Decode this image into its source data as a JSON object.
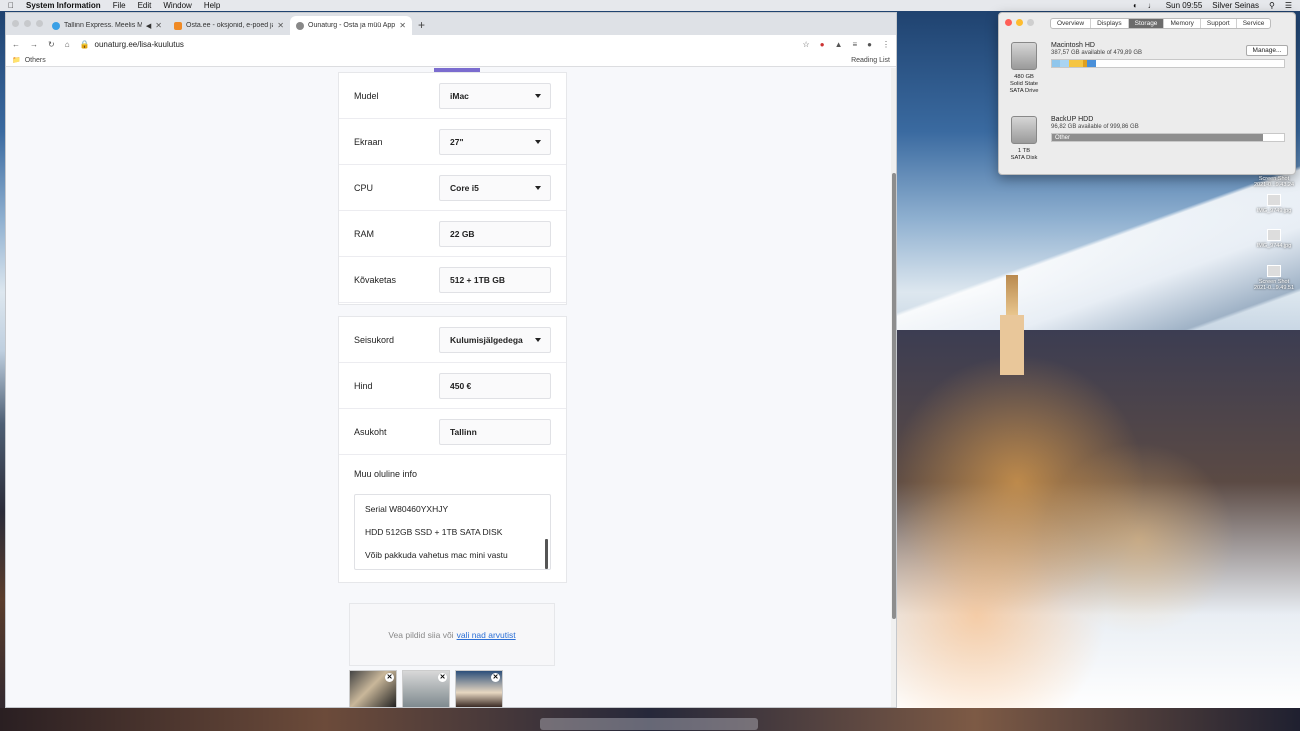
{
  "menubar": {
    "app": "System Information",
    "items": [
      "File",
      "Edit",
      "Window",
      "Help"
    ],
    "clock": "Sun 09:55",
    "user": "Silver Seinas"
  },
  "browser": {
    "tabs": [
      {
        "title": "Tallinn Express. Meelis Me",
        "color": "#3aa0e6"
      },
      {
        "title": "Osta.ee - oksjonid, e-poed ja t",
        "color": "#f08a24"
      },
      {
        "title": "Õunaturg - Osta ja müü Apple",
        "color": "#888888"
      }
    ],
    "url": "ounaturg.ee/lisa-kuulutus",
    "bookmark": "Others",
    "reading_list": "Reading List"
  },
  "form": {
    "group1": [
      {
        "label": "Mudel",
        "value": "iMac",
        "dropdown": true
      },
      {
        "label": "Ekraan",
        "value": "27\"",
        "dropdown": true
      },
      {
        "label": "CPU",
        "value": "Core i5",
        "dropdown": true
      },
      {
        "label": "RAM",
        "value": "22 GB",
        "dropdown": false
      },
      {
        "label": "Kõvaketas",
        "value": "512 + 1TB GB",
        "dropdown": false
      }
    ],
    "group2": [
      {
        "label": "Seisukord",
        "value": "Kulumisjälgedega",
        "dropdown": true
      },
      {
        "label": "Hind",
        "value": "450 €",
        "dropdown": false
      },
      {
        "label": "Asukoht",
        "value": "Tallinn",
        "dropdown": false
      }
    ],
    "notes_label": "Muu oluline info",
    "notes": [
      "Serial W80460YXHJY",
      "HDD 512GB SSD + 1TB SATA DISK",
      "Võib pakkuda vahetus mac mini vastu"
    ],
    "upload_text": "Vea pildid siia või",
    "upload_link": "vali nad arvutist"
  },
  "sysinfo": {
    "tabs": [
      "Overview",
      "Displays",
      "Storage",
      "Memory",
      "Support",
      "Service"
    ],
    "active_tab": "Storage",
    "manage": "Manage...",
    "disks": [
      {
        "name": "Macintosh HD",
        "avail": "387,57 GB available of 479,89 GB",
        "cap1": "480 GB",
        "cap2": "Solid State",
        "cap3": "SATA Drive"
      },
      {
        "name": "BackUP HDD",
        "avail": "96,82 GB available of 999,86 GB",
        "cap1": "1 TB",
        "cap2": "SATA Disk",
        "cap3": "",
        "bar_label": "Other"
      }
    ]
  },
  "desktop": {
    "icons": [
      "Screen Shot 2021-0...9.43.24",
      "IMG_9749.jpg",
      "IMG_9744.jpg",
      "Screen Shot 2021-0...9.49.51"
    ]
  }
}
